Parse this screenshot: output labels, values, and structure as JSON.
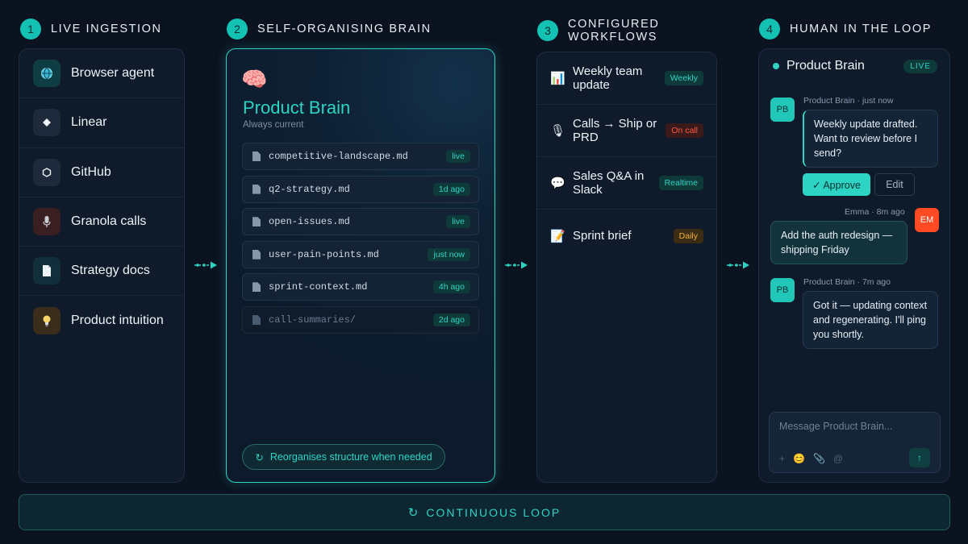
{
  "sections": [
    {
      "num": "1",
      "title": "LIVE INGESTION"
    },
    {
      "num": "2",
      "title": "SELF-ORGANISING BRAIN"
    },
    {
      "num": "3",
      "title": "CONFIGURED WORKFLOWS"
    },
    {
      "num": "4",
      "title": "HUMAN IN THE LOOP"
    }
  ],
  "sources": [
    {
      "label": "Browser agent",
      "icon": "globe-icon",
      "color": "#0f3d44"
    },
    {
      "label": "Linear",
      "icon": "diamond-icon",
      "color": "#1e2a3b"
    },
    {
      "label": "GitHub",
      "icon": "hexagon-icon",
      "color": "#1e2a3b"
    },
    {
      "label": "Granola calls",
      "icon": "microphone-icon",
      "color": "#3a1f22"
    },
    {
      "label": "Strategy docs",
      "icon": "document-icon",
      "color": "#102f3b"
    },
    {
      "label": "Product intuition",
      "icon": "lightbulb-icon",
      "color": "#3a2d1c"
    }
  ],
  "brain": {
    "emoji": "🧠",
    "title": "Product Brain",
    "subtitle": "Always current",
    "files": [
      {
        "name": "competitive-landscape.md",
        "badge": "live"
      },
      {
        "name": "q2-strategy.md",
        "badge": "1d ago"
      },
      {
        "name": "open-issues.md",
        "badge": "live"
      },
      {
        "name": "user-pain-points.md",
        "badge": "just now"
      },
      {
        "name": "sprint-context.md",
        "badge": "4h ago"
      },
      {
        "name": "call-summaries/",
        "badge": "2d ago"
      }
    ],
    "reorg_label": "Reorganises structure when needed"
  },
  "workflows": [
    {
      "icon": "📊",
      "label": "Weekly team update",
      "badge": "Weekly",
      "badge_bg": "#0f3a3a",
      "badge_fg": "#2dd4c4"
    },
    {
      "icon": "🎙",
      "label": "Calls → Ship or PRD",
      "badge": "On call",
      "badge_bg": "#3b1a1c",
      "badge_fg": "#ff5a40"
    },
    {
      "icon": "💬",
      "label": "Sales Q&A in Slack",
      "badge": "Realtime",
      "badge_bg": "#0f3a3a",
      "badge_fg": "#2dd4c4"
    },
    {
      "icon": "📝",
      "label": "Sprint brief",
      "badge": "Daily",
      "badge_bg": "#3a2d14",
      "badge_fg": "#f0b13a"
    }
  ],
  "chat": {
    "title": "Product Brain",
    "live": "LIVE",
    "messages": [
      {
        "avatar": "PB",
        "meta": "Product Brain · just now",
        "text": "Weekly update drafted. Want to review before I send?"
      },
      {
        "avatar": "EM",
        "meta": "Emma · 8m ago",
        "text": "Add the auth redesign — shipping Friday"
      },
      {
        "avatar": "PB",
        "meta": "Product Brain · 7m ago",
        "text": "Got it — updating context and regenerating. I'll ping you shortly."
      }
    ],
    "approve_label": "✓ Approve",
    "edit_label": "Edit",
    "input_placeholder": "Message Product Brain...",
    "tools": [
      "+",
      "😊",
      "📎",
      "@"
    ],
    "send_icon": "↑"
  },
  "loop": {
    "icon": "↻",
    "label": "CONTINUOUS LOOP"
  }
}
